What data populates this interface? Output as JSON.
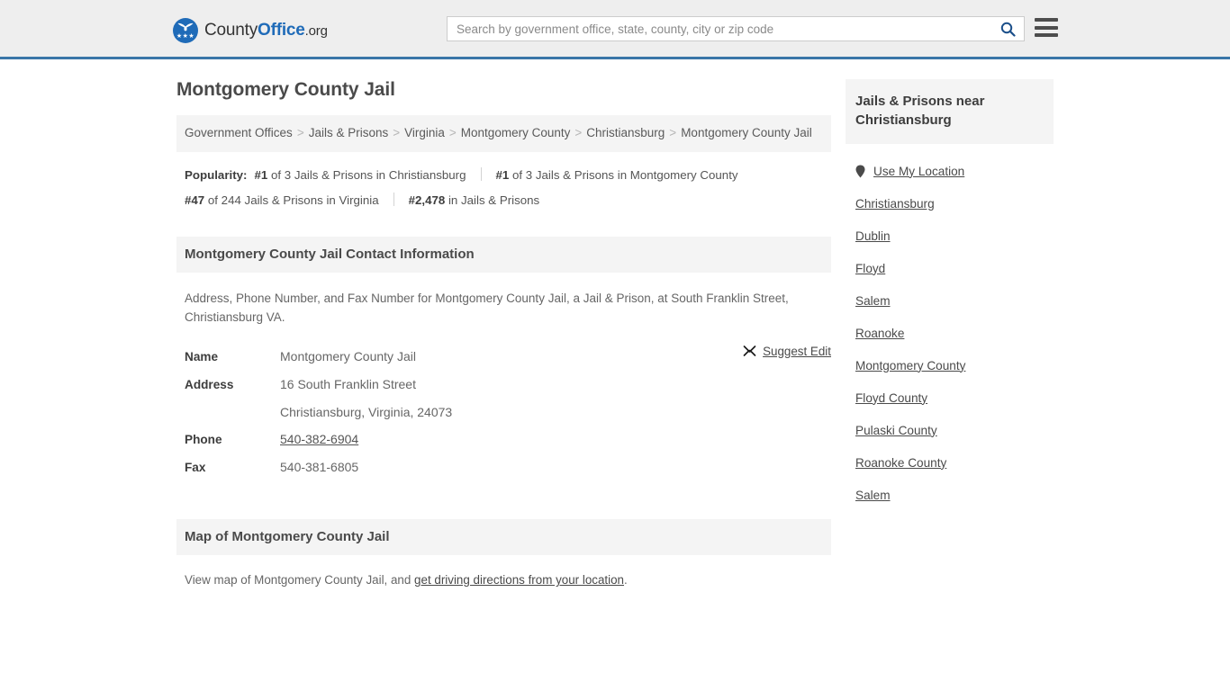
{
  "header": {
    "logo": {
      "part1": "County",
      "part2": "Office",
      "part3": ".org"
    },
    "search": {
      "placeholder": "Search by government office, state, county, city or zip code",
      "value": "",
      "icon": "search-icon"
    },
    "menu_icon": "hamburger-menu-icon",
    "accent_color": "#3a76a8"
  },
  "main": {
    "title": "Montgomery County Jail",
    "breadcrumb": {
      "separator": ">",
      "items": [
        "Government Offices",
        "Jails & Prisons",
        "Virginia",
        "Montgomery County",
        "Christiansburg",
        "Montgomery County Jail"
      ]
    },
    "popularity": {
      "label": "Popularity:",
      "entries": [
        {
          "rank": "#1",
          "text": "of 3 Jails & Prisons in Christiansburg"
        },
        {
          "rank": "#1",
          "text": "of 3 Jails & Prisons in Montgomery County"
        },
        {
          "rank": "#47",
          "text": "of 244 Jails & Prisons in Virginia"
        },
        {
          "rank": "#2,478",
          "text": "in Jails & Prisons"
        }
      ]
    },
    "contact_section": {
      "heading": "Montgomery County Jail Contact Information",
      "description": "Address, Phone Number, and Fax Number for Montgomery County Jail, a Jail & Prison, at South Franklin Street, Christiansburg VA.",
      "suggest_edit": {
        "label": "Suggest Edit",
        "icon": "pencil-edit-icon"
      },
      "rows": [
        {
          "label": "Name",
          "value": "Montgomery County Jail",
          "link": false
        },
        {
          "label": "Address",
          "value": "16 South Franklin Street",
          "link": false
        },
        {
          "label": "",
          "value": "Christiansburg, Virginia, 24073",
          "link": false
        },
        {
          "label": "Phone",
          "value": "540-382-6904",
          "link": true
        },
        {
          "label": "Fax",
          "value": "540-381-6805",
          "link": false
        }
      ]
    },
    "map_section": {
      "heading": "Map of Montgomery County Jail",
      "text_before": "View map of Montgomery County Jail, and ",
      "link_text": "get driving directions from your location",
      "text_after": "."
    }
  },
  "sidebar": {
    "heading": "Jails & Prisons near Christiansburg",
    "use_my_location": {
      "label": "Use My Location",
      "icon": "map-pin-icon"
    },
    "links": [
      "Christiansburg",
      "Dublin",
      "Floyd",
      "Salem",
      "Roanoke",
      "Montgomery County",
      "Floyd County",
      "Pulaski County",
      "Roanoke County",
      "Salem"
    ]
  }
}
